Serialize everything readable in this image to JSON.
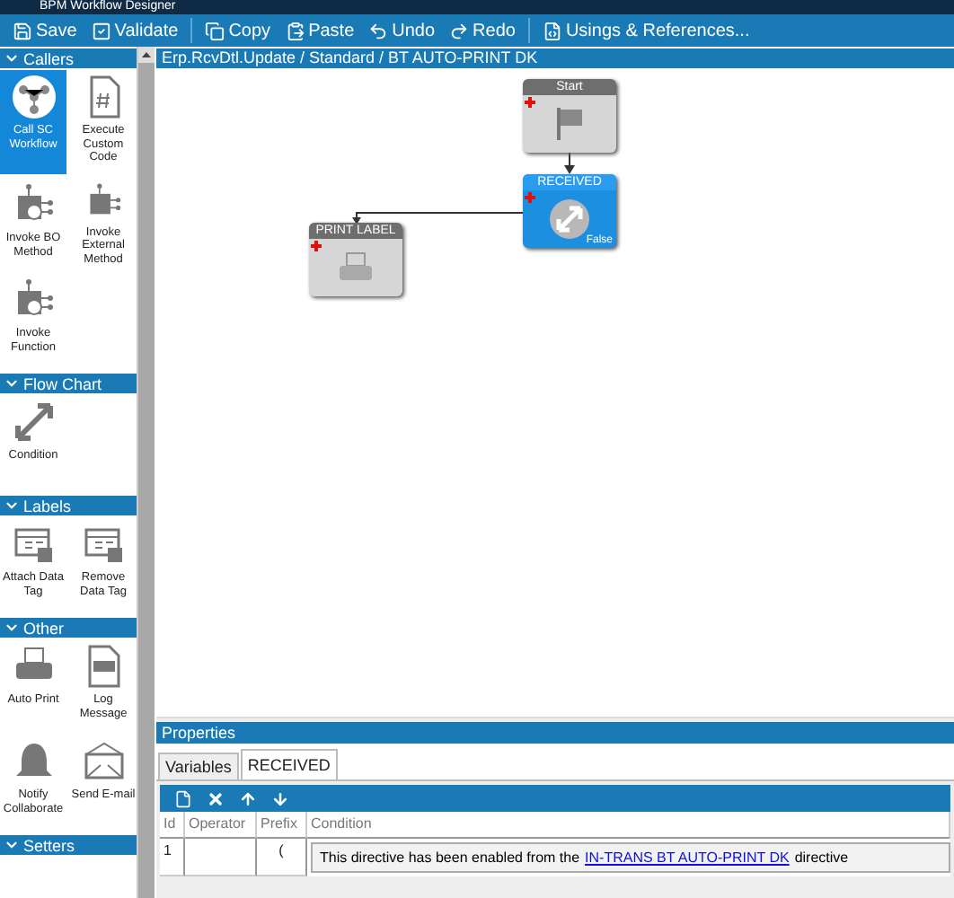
{
  "window": {
    "title": "BPM Workflow Designer"
  },
  "toolbar": [
    {
      "label": "Save"
    },
    {
      "label": "Validate"
    },
    {
      "label": "Copy"
    },
    {
      "label": "Paste"
    },
    {
      "label": "Undo"
    },
    {
      "label": "Redo"
    },
    {
      "label": "Usings & References..."
    }
  ],
  "palette": [
    {
      "title": "Callers",
      "items": [
        {
          "label": "Call SC Workflow",
          "selected": true
        },
        {
          "label": "Execute Custom Code",
          "selected": false
        },
        {
          "label": "Invoke BO Method",
          "selected": false
        },
        {
          "label": "Invoke External Method",
          "selected": false
        },
        {
          "label": "Invoke Function",
          "selected": false
        }
      ]
    },
    {
      "title": "Flow Chart",
      "items": [
        {
          "label": "Condition",
          "selected": false
        }
      ]
    },
    {
      "title": "Labels",
      "items": [
        {
          "label": "Attach Data Tag",
          "selected": false
        },
        {
          "label": "Remove Data Tag",
          "selected": false
        }
      ]
    },
    {
      "title": "Other",
      "items": [
        {
          "label": "Auto Print",
          "selected": false
        },
        {
          "label": "Log Message",
          "selected": false
        },
        {
          "label": "Notify Collaborate",
          "selected": false
        },
        {
          "label": "Send E-mail",
          "selected": false
        }
      ]
    },
    {
      "title": "Setters"
    }
  ],
  "breadcrumb": "Erp.RcvDtl.Update / Standard / BT AUTO-PRINT DK",
  "nodes": [
    {
      "title": "Start",
      "selected": false
    },
    {
      "title": "RECEIVED",
      "selected": true,
      "outcome": "False"
    },
    {
      "title": "PRINT LABEL",
      "selected": false
    }
  ],
  "properties": {
    "title": "Properties",
    "tabs": [
      {
        "label": "Variables",
        "selected": false
      },
      {
        "label": "RECEIVED",
        "selected": true
      }
    ],
    "columns": [
      "Id",
      "Operator",
      "Prefix",
      "Condition"
    ],
    "rows": [
      {
        "id": "1",
        "prefix": "(",
        "condition": {
          "before": "This directive has been enabled from the",
          "link": "IN-TRANS BT AUTO-PRINT DK",
          "after": "directive"
        }
      }
    ]
  }
}
